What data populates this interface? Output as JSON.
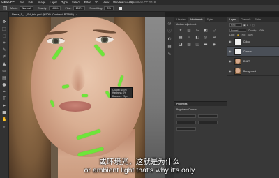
{
  "menubar": {
    "app_name": "oshop CC",
    "items": [
      "File",
      "Edit",
      "Image",
      "Layer",
      "Type",
      "Select",
      "Filter",
      "3D",
      "View",
      "Window",
      "Help"
    ],
    "window_title": "Adobe Photoshop CC 2018"
  },
  "options": {
    "size_label": "Size:",
    "mode_label": "Mode:",
    "mode_value": "Normal",
    "opacity_label": "Opacity:",
    "opacity_value": "100%",
    "flow_label": "Flow:",
    "flow_value": "100%",
    "smoothing_label": "Smoothing:",
    "smoothing_value": "0%"
  },
  "document_tab": {
    "name": "Nerea_1_..._SV_thin.psd @ 50% (Contrast, RGB/8*)",
    "close": "×"
  },
  "tooltip": {
    "line1": "Opacity: 100%",
    "line2": "Hardness: 0%",
    "line3": "Diameter: 70px"
  },
  "subtitles": {
    "chinese": "或环境光，这就是为什么",
    "english": "or ambient light that's why it's only"
  },
  "panels": {
    "libraries_tab": "Libraries",
    "adjustments_tab": "Adjustments",
    "styles_tab": "Styles",
    "adjustments_title": "Add an adjustment",
    "properties_title": "Properties",
    "properties_sub": "Brightness/Contrast",
    "layers_tab": "Layers",
    "channels_tab": "Channels",
    "paths_tab": "Paths",
    "filter_kind": "Kind",
    "blend_mode": "Normal",
    "opacity_label": "Opacity:",
    "opacity_value": "100%",
    "fill_label": "Fill:",
    "fill_value": "100%",
    "lock_label": "Lock:"
  },
  "layers": [
    {
      "name": "Colour",
      "thumb": "white",
      "active": false
    },
    {
      "name": "Contrast",
      "thumb": "white",
      "active": true
    },
    {
      "name": "DS&T",
      "thumb": "photo",
      "active": false
    },
    {
      "name": "Background",
      "thumb": "photo",
      "active": false
    }
  ]
}
